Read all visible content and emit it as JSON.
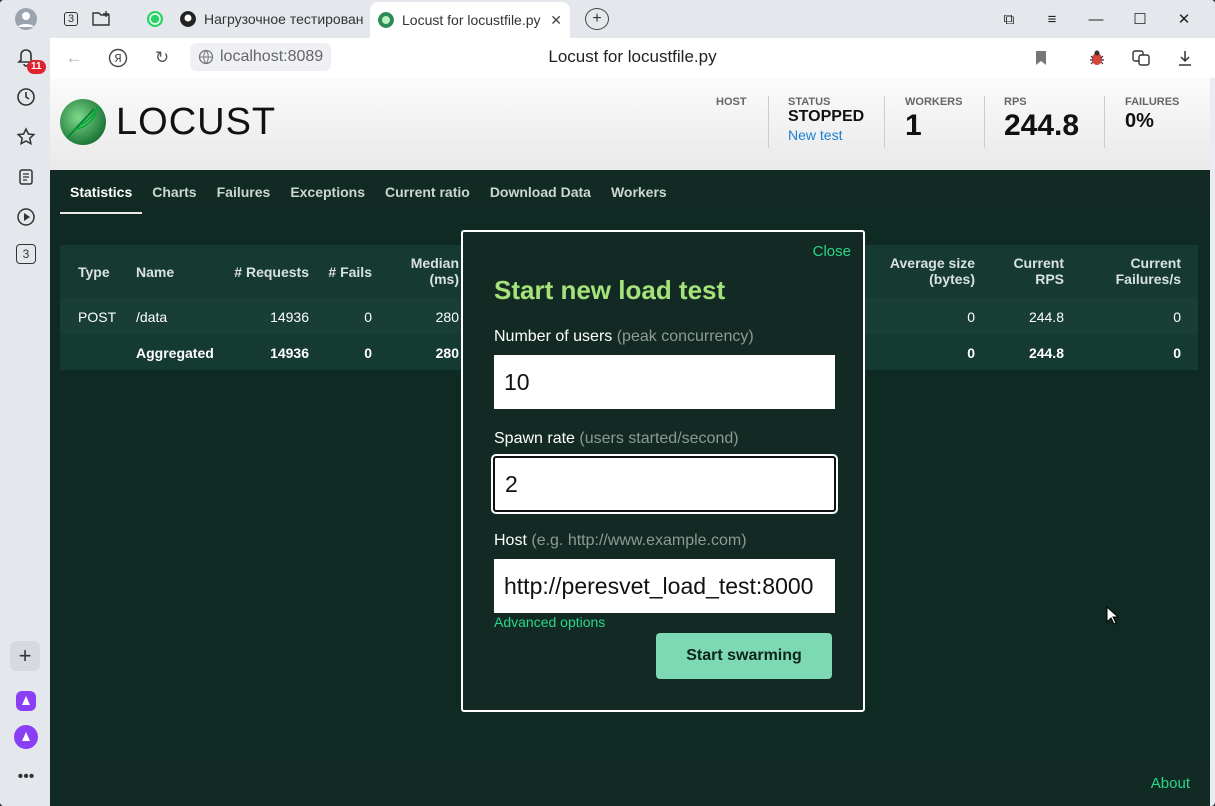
{
  "browser": {
    "tabs": [
      {
        "label": "3",
        "kind": "tab-counter"
      },
      {
        "label": "Нагрузочное тестирован",
        "favicon": "github-icon"
      },
      {
        "label": "Locust for locustfile.py",
        "favicon": "locust-icon",
        "active": true
      }
    ],
    "notification_count": "11",
    "sidebar_counter": "3",
    "url": "localhost:8089",
    "page_title": "Locust for locustfile.py"
  },
  "header": {
    "logo_text": "LOCUST",
    "host_label": "HOST",
    "status_label": "STATUS",
    "status_value": "STOPPED",
    "new_test_link": "New test",
    "workers_label": "WORKERS",
    "workers_value": "1",
    "rps_label": "RPS",
    "rps_value": "244.8",
    "failures_label": "FAILURES",
    "failures_value": "0%"
  },
  "nav": {
    "tabs": [
      "Statistics",
      "Charts",
      "Failures",
      "Exceptions",
      "Current ratio",
      "Download Data",
      "Workers"
    ],
    "active": "Statistics"
  },
  "table": {
    "headers": {
      "type": "Type",
      "name": "Name",
      "requests": "# Requests",
      "fails": "# Fails",
      "median_1": "Median",
      "median_2": "(ms)",
      "avg_size_1": "Average size",
      "avg_size_2": "(bytes)",
      "rps_1": "Current",
      "rps_2": "RPS",
      "fail_s_1": "Current",
      "fail_s_2": "Failures/s"
    },
    "rows": [
      {
        "type": "POST",
        "name": "/data",
        "requests": "14936",
        "fails": "0",
        "median": "280",
        "avg_size": "0",
        "rps": "244.8",
        "fail_s": "0"
      },
      {
        "type": "",
        "name": "Aggregated",
        "requests": "14936",
        "fails": "0",
        "median": "280",
        "avg_size": "0",
        "rps": "244.8",
        "fail_s": "0"
      }
    ]
  },
  "modal": {
    "close": "Close",
    "title": "Start new load test",
    "users_label": "Number of users",
    "users_hint": "(peak concurrency)",
    "users_value": "10",
    "spawn_label": "Spawn rate",
    "spawn_hint": "(users started/second)",
    "spawn_value": "2",
    "host_label": "Host",
    "host_hint": "(e.g. http://www.example.com)",
    "host_value": "http://peresvet_load_test:8000",
    "advanced": "Advanced options",
    "start_button": "Start swarming"
  },
  "footer": {
    "about": "About"
  },
  "colors": {
    "accent": "#2ad68a",
    "title_green": "#a6e27a",
    "button": "#7dd8b4",
    "page_bg": "#0f2a23"
  }
}
